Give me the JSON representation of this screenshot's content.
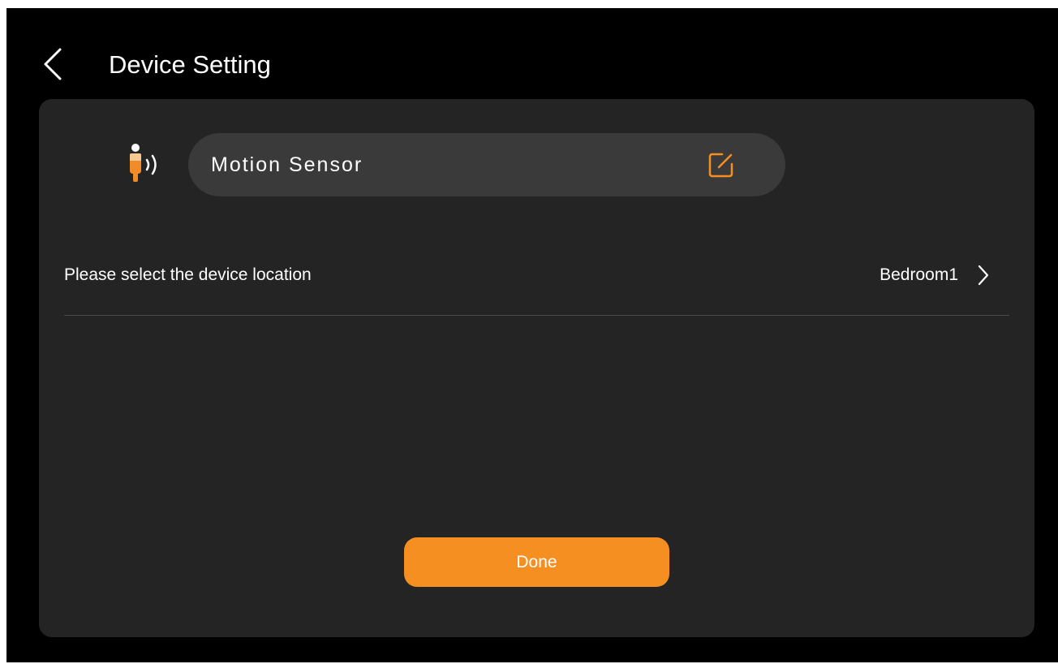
{
  "header": {
    "title": "Device Setting",
    "back_icon": "chevron-left-icon"
  },
  "device": {
    "icon": "motion-sensor-icon",
    "name": "Motion Sensor",
    "edit_icon": "edit-icon"
  },
  "location": {
    "label": "Please select the device location",
    "value": "Bedroom1",
    "chevron_icon": "chevron-right-icon"
  },
  "actions": {
    "done_label": "Done"
  },
  "colors": {
    "background": "#000000",
    "card": "#242424",
    "pill": "#3a3a3a",
    "accent": "#f68f21",
    "text": "#ffffff",
    "divider": "#4a4a4a"
  }
}
